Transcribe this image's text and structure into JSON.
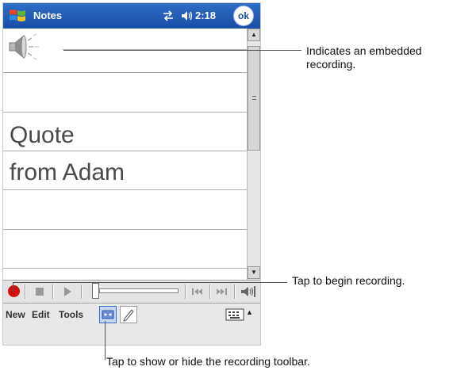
{
  "titlebar": {
    "app_title": "Notes",
    "time": "2:18",
    "ok_label": "ok"
  },
  "note": {
    "lines": [
      "Quote",
      "from Adam"
    ]
  },
  "recording_toolbar": {
    "buttons": [
      "record-icon",
      "stop-icon",
      "play-icon",
      "skip-back-icon",
      "skip-forward-icon",
      "speaker-volume-icon"
    ]
  },
  "menubar": {
    "new_label": "New",
    "edit_label": "Edit",
    "tools_label": "Tools"
  },
  "callouts": {
    "embedded_recording_line1": "Indicates an embedded",
    "embedded_recording_line2": "recording.",
    "begin_recording": "Tap to begin recording.",
    "toggle_toolbar": "Tap to show or hide the recording toolbar."
  },
  "colors": {
    "titlebar": "#1b4ea5",
    "record": "#d21010"
  }
}
